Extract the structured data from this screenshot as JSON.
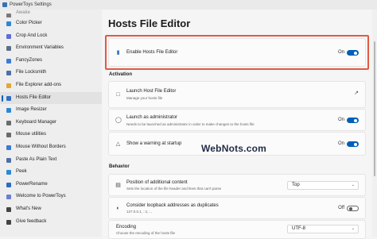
{
  "window": {
    "title": "PowerToys Settings"
  },
  "sidebar": {
    "items": [
      {
        "label": "Awake",
        "icon": "awake-icon",
        "color": "#7a7a7a"
      },
      {
        "label": "Color Picker",
        "icon": "color-picker-icon",
        "color": "#2b88d8"
      },
      {
        "label": "Crop And Lock",
        "icon": "crop-icon",
        "color": "#5b6fd6"
      },
      {
        "label": "Environment Variables",
        "icon": "environment-variables-icon",
        "color": "#5a6f8a"
      },
      {
        "label": "FancyZones",
        "icon": "fancyzones-icon",
        "color": "#3a7bd5"
      },
      {
        "label": "File Locksmith",
        "icon": "file-locksmith-icon",
        "color": "#4f6fa8"
      },
      {
        "label": "File Explorer add-ons",
        "icon": "file-explorer-icon",
        "color": "#e2a830"
      },
      {
        "label": "Hosts File Editor",
        "icon": "hosts-file-editor-icon",
        "color": "#2f6ec8",
        "active": true
      },
      {
        "label": "Image Resizer",
        "icon": "image-resizer-icon",
        "color": "#2b88d8"
      },
      {
        "label": "Keyboard Manager",
        "icon": "keyboard-icon",
        "color": "#6b6b6b"
      },
      {
        "label": "Mouse utilities",
        "icon": "mouse-icon",
        "color": "#6b6b6b"
      },
      {
        "label": "Mouse Without Borders",
        "icon": "mouse-without-borders-icon",
        "color": "#3a7bd5"
      },
      {
        "label": "Paste As Plain Text",
        "icon": "paste-icon",
        "color": "#4f6fa8"
      },
      {
        "label": "Peek",
        "icon": "peek-icon",
        "color": "#2b88d8"
      },
      {
        "label": "PowerRename",
        "icon": "powerrename-icon",
        "color": "#2b6cc4"
      },
      {
        "label": "Welcome to PowerToys",
        "icon": "welcome-icon",
        "color": "#6b7fd6"
      },
      {
        "label": "What's New",
        "icon": "whats-new-icon",
        "color": "#444444"
      },
      {
        "label": "Give feedback",
        "icon": "feedback-icon",
        "color": "#444444"
      }
    ]
  },
  "main": {
    "title": "Hosts File Editor",
    "enable": {
      "label": "Enable Hosts File Editor",
      "state": "On",
      "on": true
    },
    "activation": {
      "heading": "Activation",
      "launch": {
        "title": "Launch Host File Editor",
        "subtitle": "Manage your hosts file"
      },
      "admin": {
        "title": "Launch as administrator",
        "subtitle": "Needs to be launched as administrator in order to make changes to the hosts file",
        "state": "On",
        "on": true
      },
      "warning": {
        "title": "Show a warning at startup",
        "state": "On",
        "on": true
      }
    },
    "behavior": {
      "heading": "Behavior",
      "position": {
        "title": "Position of additional content",
        "subtitle": "Sets the location of the file header and lines that can't parse",
        "value": "Top"
      },
      "loopback": {
        "title": "Consider loopback addresses as duplicates",
        "subtitle": "127.0.0.1, ::1, ...",
        "state": "Off",
        "on": false
      },
      "encoding": {
        "title": "Encoding",
        "subtitle": "Choose the encoding of the hosts file",
        "value": "UTF-8"
      }
    }
  },
  "watermark": "WebNots.com",
  "colors": {
    "accent": "#005fb8",
    "highlight": "#e05a44"
  }
}
